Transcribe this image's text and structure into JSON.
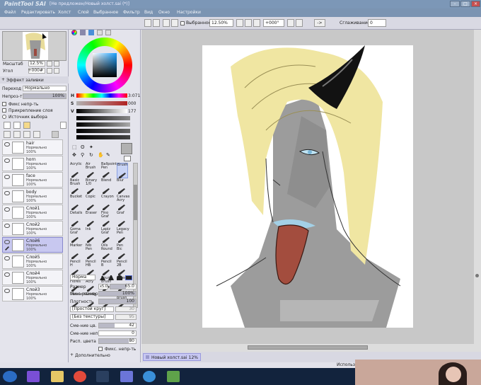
{
  "app": {
    "logo": "PaintTool SAI",
    "window_title": "[Не предложен/Новый холст.sai (*)]"
  },
  "menu": [
    "Файл",
    "Редактировать",
    "Холст",
    "Слой",
    "Выбранное",
    "Фильтр",
    "Вид",
    "Окно",
    "Настройки"
  ],
  "toolbar": {
    "selection_label": "Выбранное",
    "zoom": "12.50%",
    "rotation": "+000°",
    "arrow": "->",
    "stabilizer_label": "Сглаживание",
    "stabilizer_value": "0"
  },
  "navigator": {
    "zoom_label": "Масштаб",
    "zoom_value": "12.5%",
    "angle_label": "Угол",
    "angle_value": "+000#"
  },
  "layer_props": {
    "effect_label": "Эффект заливки",
    "blend_label": "Переход",
    "blend_value": "Нормально",
    "opacity_label": "Непроз-ть",
    "opacity_value": "100%",
    "opacity_fraction": 1.0,
    "fix_opacity": "Фикс непр-ть",
    "clip_layer": "Прикрепление слоя",
    "selection_source": "Источник выбора"
  },
  "layers": [
    {
      "name": "hair",
      "mode": "Нормально",
      "opacity": "100%",
      "selected": false
    },
    {
      "name": "horn",
      "mode": "Нормально",
      "opacity": "100%",
      "selected": false
    },
    {
      "name": "face",
      "mode": "Нормально",
      "opacity": "100%",
      "selected": false
    },
    {
      "name": "body",
      "mode": "Нормально",
      "opacity": "100%",
      "selected": false
    },
    {
      "name": "Слой1",
      "mode": "Нормально",
      "opacity": "100%",
      "selected": false
    },
    {
      "name": "Слой2",
      "mode": "Нормально",
      "opacity": "100%",
      "selected": false
    },
    {
      "name": "Слой6",
      "mode": "Нормально",
      "opacity": "100%",
      "selected": true
    },
    {
      "name": "Слой5",
      "mode": "Нормально",
      "opacity": "100%",
      "selected": false
    },
    {
      "name": "Слой4",
      "mode": "Нормально",
      "opacity": "100%",
      "selected": false
    },
    {
      "name": "Слой3",
      "mode": "Нормально",
      "opacity": "100%",
      "selected": false
    }
  ],
  "color": {
    "h_label": "H",
    "h_value": "3:071",
    "s_label": "S",
    "s_value": "000",
    "v_label": "V",
    "v_value": "177",
    "current": "#b1b1b1"
  },
  "tools": [
    [
      "Acrylic",
      "Air Brush",
      "Ballpoint Pen",
      "Brush"
    ],
    [
      "Basic Brush",
      "Binary 1/0",
      "Blend",
      "Blur"
    ],
    [
      "Bucket",
      "Copic",
      "Crayon",
      "Canvas Acry"
    ],
    [
      "Details",
      "Eraser",
      "Fino Graf",
      "Graf"
    ],
    [
      "Goma Graf",
      "Ink",
      "Lapiz Graf",
      "Legacy Pen"
    ],
    [
      "Marker",
      "Nib Pen",
      "Oils Round",
      "Pen Bic"
    ],
    [
      "Pencil H",
      "Pencil HB",
      "Pencil B",
      "Pencil 2B"
    ],
    [
      "Prueba Flores",
      "Paper Acry",
      "Round Brush",
      "Select"
    ],
    [
      "Deselect",
      "Smdg",
      "Splash",
      "Square Brush"
    ]
  ],
  "brush": {
    "mode": "Норма",
    "size_label": "Размер",
    "size_mult": "x5.0",
    "size_value": "65.0",
    "min_size_label": "Мин. размер",
    "min_size_value": "100%",
    "density_label": "Плотность",
    "density_value": "100",
    "shape": "[Простой круг]",
    "shape_amount": "30",
    "texture": "[Без текстуры]",
    "texture_amount": "95",
    "blend_label": "Сме-ние цв.",
    "blend_value": "42",
    "dilution_label": "Сме-ние непр.",
    "dilution_value": "0",
    "persistence_label": "Расп. цвета",
    "persistence_value": "80",
    "keep_opacity": "Фикс. непр-ть",
    "advanced": "Дополнительно"
  },
  "canvas_tab": {
    "name": "Новый холст.sai",
    "zoom": "12%"
  },
  "status": {
    "text": "Использо"
  }
}
